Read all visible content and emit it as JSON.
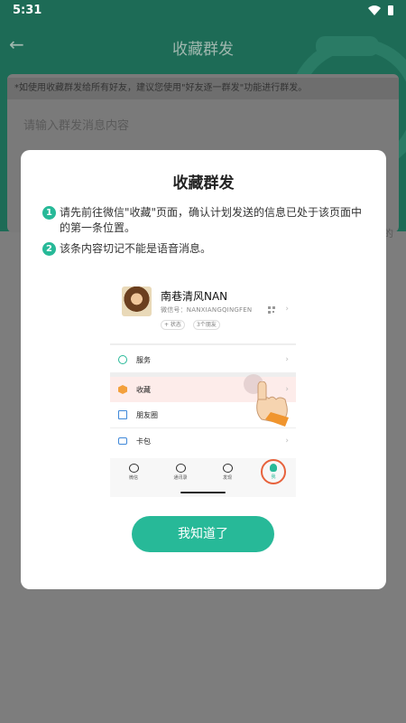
{
  "status_bar": {
    "time": "5:31"
  },
  "background": {
    "title": "收藏群发",
    "notice": "*如使用收藏群发给所有好友，建议您使用\"好友逐一群发\"功能进行群发。",
    "input_placeholder": "请输入群发消息内容",
    "side_char": "的"
  },
  "dialog": {
    "title": "收藏群发",
    "steps": [
      {
        "num": "1",
        "text": "请先前往微信\"收藏\"页面，确认计划发送的信息已处于该页面中的第一条位置。"
      },
      {
        "num": "2",
        "text": "该条内容切记不能是语音消息。"
      }
    ],
    "illustration": {
      "profile_name": "南巷清风NAN",
      "wechat_id": "微信号：NANXIANGQINGFEN",
      "qr_label": "​",
      "status_chip": "+ 状态",
      "friends_chip": "3个朋友",
      "menu": [
        {
          "label": "服务",
          "icon": "service-icon"
        },
        {
          "label": "收藏",
          "icon": "favorites-icon",
          "active": true
        },
        {
          "label": "朋友圈",
          "icon": "moments-icon"
        },
        {
          "label": "卡包",
          "icon": "card-wallet-icon"
        }
      ],
      "tabs": [
        "微信",
        "通讯录",
        "发现",
        "我"
      ]
    },
    "confirm_button": "我知道了"
  },
  "colors": {
    "accent": "#27b998",
    "header_bg": "#1d6b56",
    "highlight_ring": "#e7623c"
  }
}
